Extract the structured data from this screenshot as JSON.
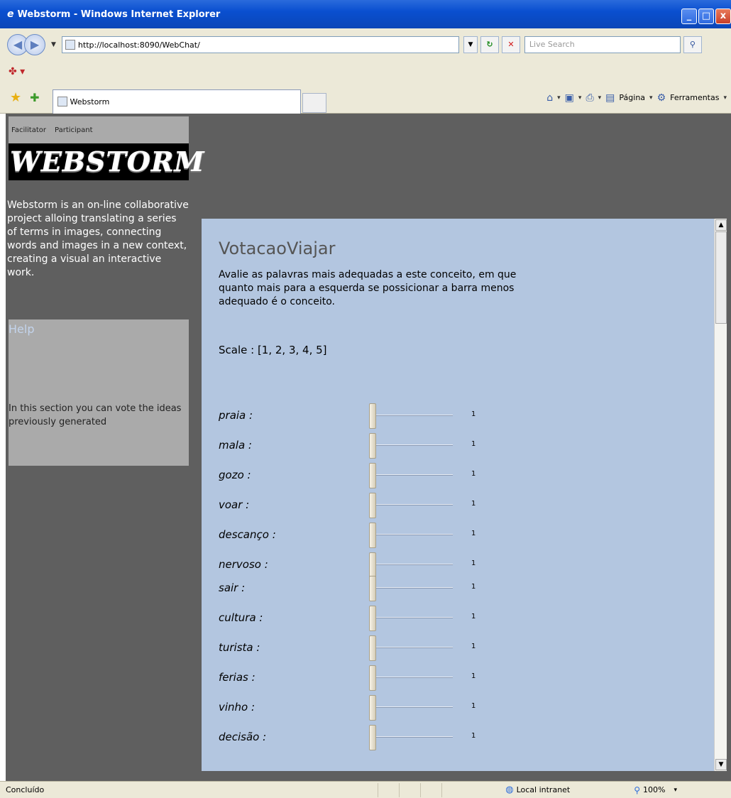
{
  "window": {
    "title": "Webstorm - Windows Internet Explorer",
    "minimize": "_",
    "maximize": "□",
    "close": "x"
  },
  "addressbar": {
    "url": "http://localhost:8090/WebChat/",
    "search_placeholder": "Live Search"
  },
  "tab": {
    "title": "Webstorm"
  },
  "commandbar": {
    "page": "Página",
    "tools": "Ferramentas"
  },
  "statusbar": {
    "status": "Concluído",
    "zone": "Local intranet",
    "zoom": "100%"
  },
  "sidebar": {
    "menu": {
      "facilitator": "Facilitator",
      "participant": "Participant"
    },
    "logo_text": "WEBSTORM",
    "description": "Webstorm is an on-line collaborative project alloing translating a series of terms in images, connecting words and images in a new context, creating a visual an interactive work.",
    "help_title": "Help",
    "help_text": "In this section you can vote the ideas previously generated"
  },
  "poll": {
    "title": "VotacaoViajar",
    "instructions": "Avalie as palavras mais adequadas a este conceito, em que quanto mais para a esquerda se possicionar a barra menos adequado é o conceito.",
    "scale": "Scale : [1, 2, 3, 4, 5]",
    "scale_values": [
      1,
      2,
      3,
      4,
      5
    ],
    "terms": [
      {
        "label": "praia :",
        "value": "1"
      },
      {
        "label": "mala :",
        "value": "1"
      },
      {
        "label": "gozo :",
        "value": "1"
      },
      {
        "label": "voar :",
        "value": "1"
      },
      {
        "label": "descanço :",
        "value": "1"
      },
      {
        "label": "nervoso :",
        "value": "1"
      },
      {
        "label": "sair :",
        "value": "1"
      },
      {
        "label": "cultura :",
        "value": "1"
      },
      {
        "label": "turista :",
        "value": "1"
      },
      {
        "label": "ferias :",
        "value": "1"
      },
      {
        "label": "vinho :",
        "value": "1"
      },
      {
        "label": "decisão :",
        "value": "1"
      }
    ]
  },
  "colors": {
    "content_bg": "#b3c6e0",
    "page_bg": "#5f5f5f",
    "sidebar_box": "#aaaaaa",
    "help_title": "#c3d4ec"
  }
}
